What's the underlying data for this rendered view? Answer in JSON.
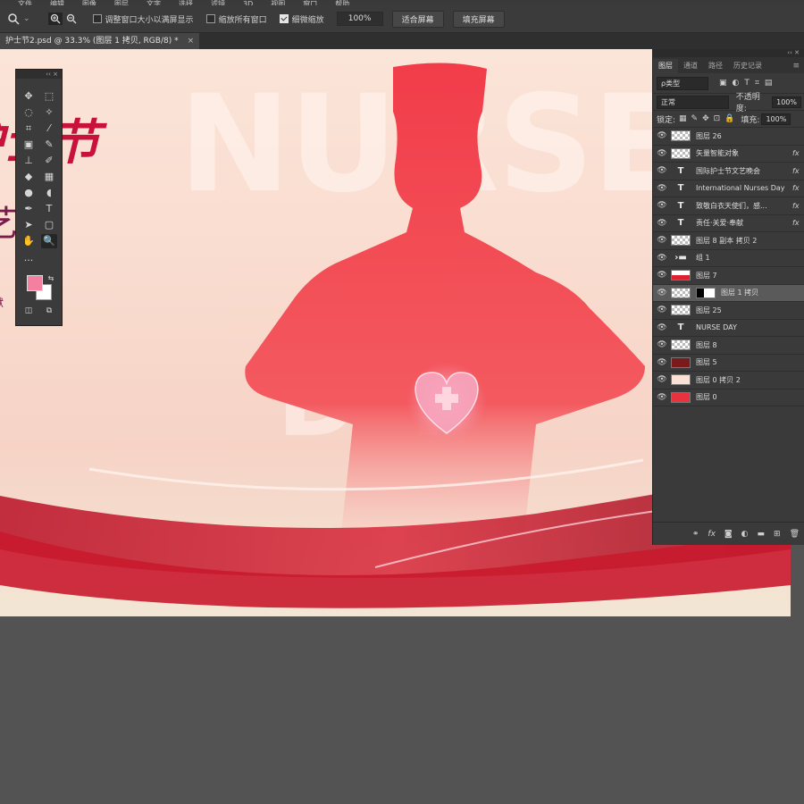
{
  "options": {
    "zoom_in_icon": "zoom-in-icon",
    "check1_label": "调整窗口大小以满屏显示",
    "check2_label": "缩放所有窗口",
    "check3_label": "细微缩放",
    "zoom_value": "100%",
    "fit_screen": "适合屏幕",
    "fill_screen": "填充屏幕"
  },
  "document": {
    "tab_title": "护士节2.psd @ 33.3% (图层 1 拷贝, RGB/8) *",
    "close": "×"
  },
  "canvas": {
    "big_text": "NURSE",
    "day_text": "D   Y",
    "title1": "护士节",
    "title2": "艺会",
    "title3": "奉献"
  },
  "panel": {
    "tabs": [
      "图层",
      "通道",
      "路径",
      "历史记录"
    ],
    "filter_label": "ρ类型",
    "blend_mode": "正常",
    "opacity_label": "不透明度:",
    "opacity_value": "100%",
    "lock_label": "锁定:",
    "fill_label": "填充:",
    "fill_value": "100%",
    "layers": [
      {
        "name": "图层 26",
        "type": "pixel",
        "fx": ""
      },
      {
        "name": "矢量智能对象",
        "type": "smart",
        "fx": "fx"
      },
      {
        "name": "国际护士节文艺晚会",
        "type": "text",
        "fx": "fx"
      },
      {
        "name": "International Nurses Day",
        "type": "text",
        "fx": "fx"
      },
      {
        "name": "致敬白衣天使们，感...",
        "type": "text",
        "fx": "fx"
      },
      {
        "name": "责任·关爱·奉献",
        "type": "text",
        "fx": "fx"
      },
      {
        "name": "图层 8 副本 拷贝 2",
        "type": "pixel",
        "fx": ""
      },
      {
        "name": "组 1",
        "type": "group",
        "fx": ""
      },
      {
        "name": "图层 7",
        "type": "pixel",
        "fx": ""
      },
      {
        "name": "图层 1 拷贝",
        "type": "masked",
        "fx": ""
      },
      {
        "name": "图层 25",
        "type": "pixel",
        "fx": ""
      },
      {
        "name": "NURSE DAY",
        "type": "text",
        "fx": ""
      },
      {
        "name": "图层 8",
        "type": "pixel",
        "fx": ""
      },
      {
        "name": "图层 5",
        "type": "pixel",
        "fx": ""
      },
      {
        "name": "图层 0 拷贝 2",
        "type": "pixel",
        "fx": ""
      },
      {
        "name": "图层 0",
        "type": "pixel",
        "fx": ""
      }
    ],
    "bottom_icons": [
      "link-icon",
      "fx-icon",
      "mask-icon",
      "adjustment-icon",
      "folder-icon",
      "new-layer-icon",
      "trash-icon"
    ]
  },
  "colors": {
    "foreground": "#f57fa0",
    "background": "#ffffff",
    "accent_red": "#e8323f"
  }
}
